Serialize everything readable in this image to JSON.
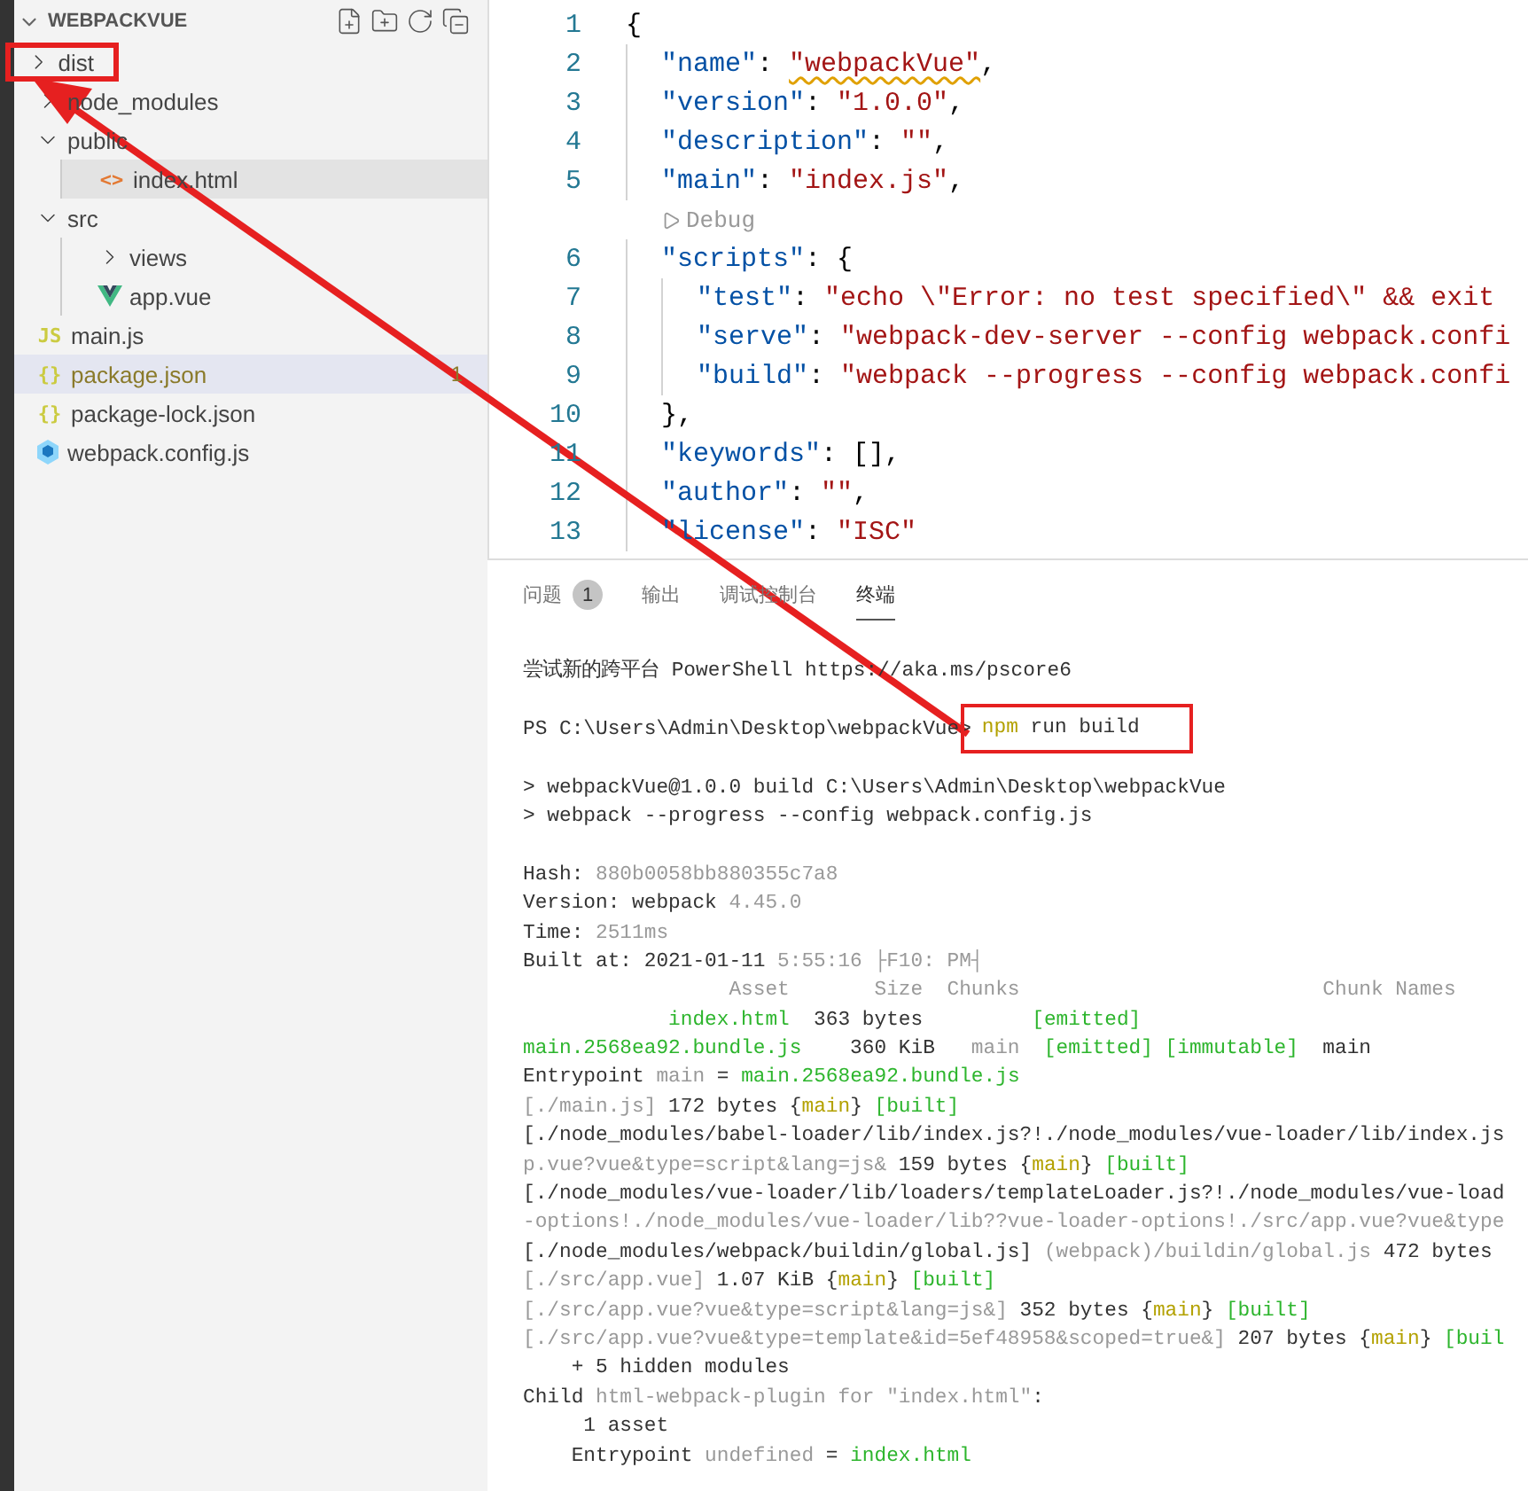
{
  "explorer": {
    "title": "WEBPACKVUE",
    "items": [
      {
        "kind": "folder",
        "label": "dist",
        "expanded": false,
        "selected": false,
        "marked": true
      },
      {
        "kind": "folder",
        "label": "node_modules",
        "expanded": false,
        "selected": false,
        "marked": false
      },
      {
        "kind": "folder",
        "label": "public",
        "expanded": true,
        "selected": false,
        "marked": false,
        "children": [
          {
            "kind": "html",
            "icon_label": "<>",
            "label": "index.html",
            "selected": false,
            "hovered": true,
            "marked": false
          }
        ]
      },
      {
        "kind": "folder",
        "label": "src",
        "expanded": true,
        "selected": false,
        "marked": false,
        "children": [
          {
            "kind": "folder",
            "label": "views",
            "expanded": false,
            "selected": false,
            "marked": false
          },
          {
            "kind": "vue",
            "label": "app.vue",
            "selected": false,
            "marked": false
          }
        ]
      },
      {
        "kind": "js",
        "icon_label": "JS",
        "label": "main.js",
        "selected": false,
        "marked": false
      },
      {
        "kind": "json",
        "icon_label": "{}",
        "label": "package.json",
        "badge": "1",
        "selected": true,
        "marked": false
      },
      {
        "kind": "json",
        "icon_label": "{}",
        "label": "package-lock.json",
        "selected": false,
        "marked": false
      },
      {
        "kind": "webpack",
        "label": "webpack.config.js",
        "selected": false,
        "marked": false
      }
    ]
  },
  "editor": {
    "lines": [
      {
        "kind": "code",
        "number": "1",
        "segs": [
          {
            "t": "{",
            "kind": "punct"
          }
        ],
        "children": [
          {
            "kind": "code",
            "number": "2",
            "segs": [
              {
                "t": "\"name\"",
                "kind": "key"
              },
              {
                "t": ": ",
                "kind": "punct"
              },
              {
                "t": "\"webpackVue\"",
                "kind": "string",
                "squiggle": true
              },
              {
                "t": ",",
                "kind": "punct"
              }
            ]
          },
          {
            "kind": "code",
            "number": "3",
            "segs": [
              {
                "t": "\"version\"",
                "kind": "key"
              },
              {
                "t": ": ",
                "kind": "punct"
              },
              {
                "t": "\"1.0.0\"",
                "kind": "string"
              },
              {
                "t": ",",
                "kind": "punct"
              }
            ]
          },
          {
            "kind": "code",
            "number": "4",
            "segs": [
              {
                "t": "\"description\"",
                "kind": "key"
              },
              {
                "t": ": ",
                "kind": "punct"
              },
              {
                "t": "\"\"",
                "kind": "string"
              },
              {
                "t": ",",
                "kind": "punct"
              }
            ]
          },
          {
            "kind": "code",
            "number": "5",
            "segs": [
              {
                "t": "\"main\"",
                "kind": "key"
              },
              {
                "t": ": ",
                "kind": "punct"
              },
              {
                "t": "\"index.js\"",
                "kind": "string"
              },
              {
                "t": ",",
                "kind": "punct"
              }
            ]
          },
          {
            "kind": "codelens",
            "text": "Debug"
          },
          {
            "kind": "code",
            "number": "6",
            "segs": [
              {
                "t": "\"scripts\"",
                "kind": "key"
              },
              {
                "t": ": {",
                "kind": "punct"
              }
            ],
            "children": [
              {
                "kind": "code",
                "number": "7",
                "segs": [
                  {
                    "t": "\"test\"",
                    "kind": "key"
                  },
                  {
                    "t": ": ",
                    "kind": "punct"
                  },
                  {
                    "t": "\"echo \\\"Error: no test specified\\\" && exit",
                    "kind": "string"
                  }
                ]
              },
              {
                "kind": "code",
                "number": "8",
                "segs": [
                  {
                    "t": "\"serve\"",
                    "kind": "key"
                  },
                  {
                    "t": ": ",
                    "kind": "punct"
                  },
                  {
                    "t": "\"webpack-dev-server --config webpack.confi",
                    "kind": "string"
                  }
                ]
              },
              {
                "kind": "code",
                "number": "9",
                "segs": [
                  {
                    "t": "\"build\"",
                    "kind": "key"
                  },
                  {
                    "t": ": ",
                    "kind": "punct"
                  },
                  {
                    "t": "\"webpack --progress --config webpack.confi",
                    "kind": "string"
                  }
                ]
              }
            ]
          },
          {
            "kind": "code",
            "number": "10",
            "segs": [
              {
                "t": "},",
                "kind": "punct"
              }
            ]
          },
          {
            "kind": "code",
            "number": "11",
            "segs": [
              {
                "t": "\"keywords\"",
                "kind": "key"
              },
              {
                "t": ": [],",
                "kind": "punct"
              }
            ]
          },
          {
            "kind": "code",
            "number": "12",
            "segs": [
              {
                "t": "\"author\"",
                "kind": "key"
              },
              {
                "t": ": ",
                "kind": "punct"
              },
              {
                "t": "\"\"",
                "kind": "string"
              },
              {
                "t": ",",
                "kind": "punct"
              }
            ]
          },
          {
            "kind": "code",
            "number": "13",
            "segs": [
              {
                "t": "\"license\"",
                "kind": "key"
              },
              {
                "t": ": ",
                "kind": "punct"
              },
              {
                "t": "\"ISC\"",
                "kind": "string"
              }
            ]
          }
        ]
      }
    ]
  },
  "panel": {
    "tabs": [
      {
        "label": "问题",
        "badge": "1",
        "selected": false
      },
      {
        "label": "输出",
        "selected": false
      },
      {
        "label": "调试控制台",
        "selected": false
      },
      {
        "label": "终端",
        "selected": true
      }
    ],
    "terminal": [
      {
        "kind": "text",
        "segs": [
          {
            "t": "尝试新的跨平台 PowerShell https://aka.ms/pscore6",
            "kind": "plain"
          }
        ]
      },
      {
        "kind": "blank"
      },
      {
        "kind": "prompt",
        "prompt": "PS C:\\Users\\Admin\\Desktop\\webpackVue>",
        "program": "npm",
        "args": " run build",
        "marked": true
      },
      {
        "kind": "blank"
      },
      {
        "kind": "text",
        "segs": [
          {
            "t": "> webpackVue@1.0.0 build C:\\Users\\Admin\\Desktop\\webpackVue",
            "kind": "plain"
          }
        ]
      },
      {
        "kind": "text",
        "segs": [
          {
            "t": "> webpack --progress --config webpack.config.js",
            "kind": "plain"
          }
        ]
      },
      {
        "kind": "blank"
      },
      {
        "kind": "text",
        "segs": [
          {
            "t": "Hash: ",
            "kind": "plain"
          },
          {
            "t": "880b0058bb880355c7a8",
            "kind": "dim"
          }
        ]
      },
      {
        "kind": "text",
        "segs": [
          {
            "t": "Version: webpack ",
            "kind": "plain"
          },
          {
            "t": "4.45.0",
            "kind": "dim"
          }
        ]
      },
      {
        "kind": "text",
        "segs": [
          {
            "t": "Time: ",
            "kind": "plain"
          },
          {
            "t": "2511ms",
            "kind": "dim"
          }
        ]
      },
      {
        "kind": "text",
        "segs": [
          {
            "t": "Built at: 2021-01-11 ",
            "kind": "plain"
          },
          {
            "t": "5:55:16 ├F10: PM┤",
            "kind": "dim"
          }
        ]
      },
      {
        "kind": "text",
        "segs": [
          {
            "t": "                 Asset       Size  Chunks                         Chunk Names",
            "kind": "dim"
          }
        ]
      },
      {
        "kind": "text",
        "segs": [
          {
            "t": "            index.html",
            "kind": "green"
          },
          {
            "t": "  363 bytes         ",
            "kind": "plain"
          },
          {
            "t": "[emitted]",
            "kind": "green"
          }
        ]
      },
      {
        "kind": "text",
        "segs": [
          {
            "t": "main.2568ea92.bundle.js",
            "kind": "green"
          },
          {
            "t": "    360 KiB   ",
            "kind": "plain"
          },
          {
            "t": "main",
            "kind": "dim"
          },
          {
            "t": "  [emitted] [immutable]",
            "kind": "green"
          },
          {
            "t": "  main",
            "kind": "plain"
          }
        ]
      },
      {
        "kind": "text",
        "segs": [
          {
            "t": "Entrypoint ",
            "kind": "plain"
          },
          {
            "t": "main",
            "kind": "dim"
          },
          {
            "t": " = ",
            "kind": "plain"
          },
          {
            "t": "main.2568ea92.bundle.js",
            "kind": "green"
          }
        ]
      },
      {
        "kind": "text",
        "segs": [
          {
            "t": "[./main.js]",
            "kind": "dim"
          },
          {
            "t": " 172 bytes {",
            "kind": "plain"
          },
          {
            "t": "main",
            "kind": "yellow"
          },
          {
            "t": "} ",
            "kind": "plain"
          },
          {
            "t": "[built]",
            "kind": "green"
          }
        ]
      },
      {
        "kind": "text",
        "segs": [
          {
            "t": "[./node_modules/babel-loader/lib/index.js?!./node_modules/vue-loader/lib/index.js",
            "kind": "plain"
          }
        ]
      },
      {
        "kind": "text",
        "segs": [
          {
            "t": "p.vue?vue&type=script&lang=js&",
            "kind": "dim"
          },
          {
            "t": " 159 bytes {",
            "kind": "plain"
          },
          {
            "t": "main",
            "kind": "yellow"
          },
          {
            "t": "} ",
            "kind": "plain"
          },
          {
            "t": "[built]",
            "kind": "green"
          }
        ]
      },
      {
        "kind": "text",
        "segs": [
          {
            "t": "[./node_modules/vue-loader/lib/loaders/templateLoader.js?!./node_modules/vue-load",
            "kind": "plain"
          }
        ]
      },
      {
        "kind": "text",
        "segs": [
          {
            "t": "-options!./node_modules/vue-loader/lib??vue-loader-options!./src/app.vue?vue&type",
            "kind": "dim"
          }
        ]
      },
      {
        "kind": "text",
        "segs": [
          {
            "t": "[./node_modules/webpack/buildin/global.js] ",
            "kind": "plain"
          },
          {
            "t": "(webpack)/buildin/global.js",
            "kind": "dim"
          },
          {
            "t": " 472 bytes",
            "kind": "plain"
          }
        ]
      },
      {
        "kind": "text",
        "segs": [
          {
            "t": "[./src/app.vue]",
            "kind": "dim"
          },
          {
            "t": " 1.07 KiB {",
            "kind": "plain"
          },
          {
            "t": "main",
            "kind": "yellow"
          },
          {
            "t": "} ",
            "kind": "plain"
          },
          {
            "t": "[built]",
            "kind": "green"
          }
        ]
      },
      {
        "kind": "text",
        "segs": [
          {
            "t": "[./src/app.vue?vue&type=script&lang=js&]",
            "kind": "dim"
          },
          {
            "t": " 352 bytes {",
            "kind": "plain"
          },
          {
            "t": "main",
            "kind": "yellow"
          },
          {
            "t": "} ",
            "kind": "plain"
          },
          {
            "t": "[built]",
            "kind": "green"
          }
        ]
      },
      {
        "kind": "text",
        "segs": [
          {
            "t": "[./src/app.vue?vue&type=template&id=5ef48958&scoped=true&]",
            "kind": "dim"
          },
          {
            "t": " 207 bytes {",
            "kind": "plain"
          },
          {
            "t": "main",
            "kind": "yellow"
          },
          {
            "t": "} ",
            "kind": "plain"
          },
          {
            "t": "[buil",
            "kind": "green"
          }
        ]
      },
      {
        "kind": "text",
        "segs": [
          {
            "t": "    + 5 hidden modules",
            "kind": "plain"
          }
        ]
      },
      {
        "kind": "text",
        "segs": [
          {
            "t": "Child ",
            "kind": "plain"
          },
          {
            "t": "html-webpack-plugin for \"index.html\"",
            "kind": "dim"
          },
          {
            "t": ":",
            "kind": "plain"
          }
        ]
      },
      {
        "kind": "text",
        "segs": [
          {
            "t": "     1 asset",
            "kind": "plain"
          }
        ]
      },
      {
        "kind": "text",
        "segs": [
          {
            "t": "    Entrypoint ",
            "kind": "plain"
          },
          {
            "t": "undefined",
            "kind": "dim"
          },
          {
            "t": " = ",
            "kind": "plain"
          },
          {
            "t": "index.html",
            "kind": "green"
          }
        ]
      }
    ]
  },
  "annotation_arrow": true
}
